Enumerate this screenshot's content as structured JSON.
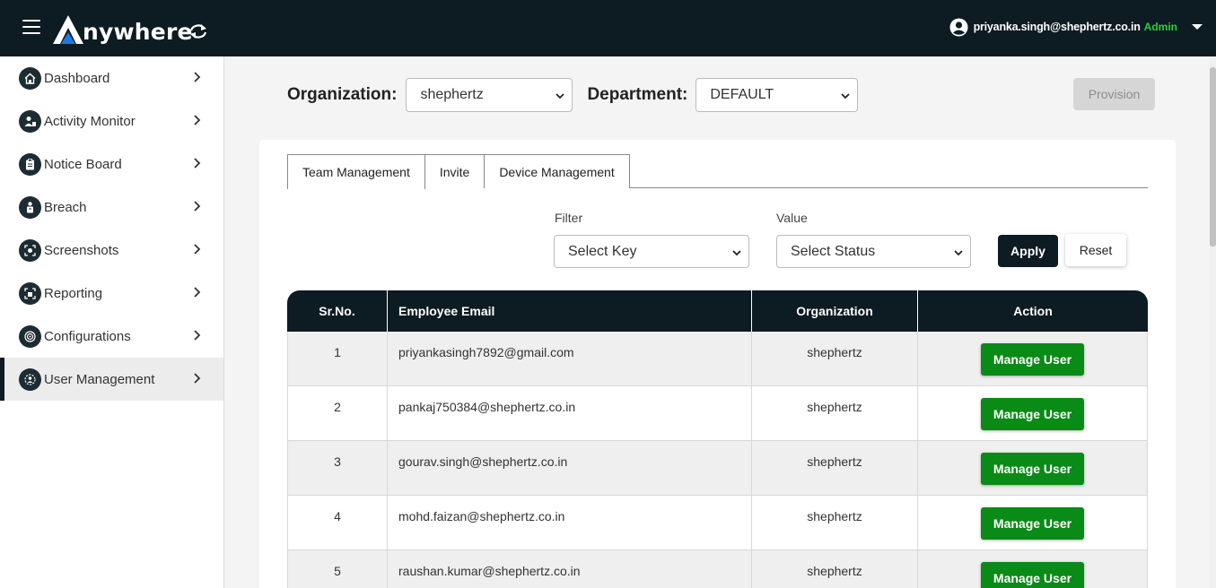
{
  "header": {
    "brand_initial": "A",
    "brand_rest": "nywhere",
    "user_email": "priyanka.singh@shephertz.co.in",
    "user_role": "Admin"
  },
  "colors": {
    "header_bg": "#0d1b22",
    "accent_blue": "#1e7ae0",
    "role_green": "#2ecc40",
    "manage_button": "#0a8a16"
  },
  "sidebar": {
    "items": [
      {
        "label": "Dashboard",
        "icon": "home-icon",
        "active": false
      },
      {
        "label": "Activity Monitor",
        "icon": "person-activity-icon",
        "active": false
      },
      {
        "label": "Notice Board",
        "icon": "clipboard-icon",
        "active": false
      },
      {
        "label": "Breach",
        "icon": "breach-person-icon",
        "active": false
      },
      {
        "label": "Screenshots",
        "icon": "screenshot-icon",
        "active": false
      },
      {
        "label": "Reporting",
        "icon": "reporting-icon",
        "active": false
      },
      {
        "label": "Configurations",
        "icon": "config-icon",
        "active": false
      },
      {
        "label": "User Management",
        "icon": "user-management-icon",
        "active": true
      }
    ]
  },
  "toolbar": {
    "org_label": "Organization:",
    "org_value": "shephertz",
    "dept_label": "Department:",
    "dept_value": "DEFAULT",
    "provision_label": "Provision"
  },
  "tabs": [
    {
      "label": "Team Management",
      "active": true
    },
    {
      "label": "Invite",
      "active": false
    },
    {
      "label": "Device Management",
      "active": false
    }
  ],
  "filters": {
    "filter_label": "Filter",
    "filter_value": "Select Key",
    "value_label": "Value",
    "value_value": "Select Status",
    "apply_label": "Apply",
    "reset_label": "Reset"
  },
  "table": {
    "headers": [
      "Sr.No.",
      "Employee Email",
      "Organization",
      "Action"
    ],
    "rows": [
      {
        "sr": "1",
        "email": "priyankasingh7892@gmail.com",
        "org": "shephertz",
        "action": "Manage User"
      },
      {
        "sr": "2",
        "email": "pankaj750384@shephertz.co.in",
        "org": "shephertz",
        "action": "Manage User"
      },
      {
        "sr": "3",
        "email": "gourav.singh@shephertz.co.in",
        "org": "shephertz",
        "action": "Manage User"
      },
      {
        "sr": "4",
        "email": "mohd.faizan@shephertz.co.in",
        "org": "shephertz",
        "action": "Manage User"
      },
      {
        "sr": "5",
        "email": "raushan.kumar@shephertz.co.in",
        "org": "shephertz",
        "action": "Manage User"
      }
    ]
  }
}
